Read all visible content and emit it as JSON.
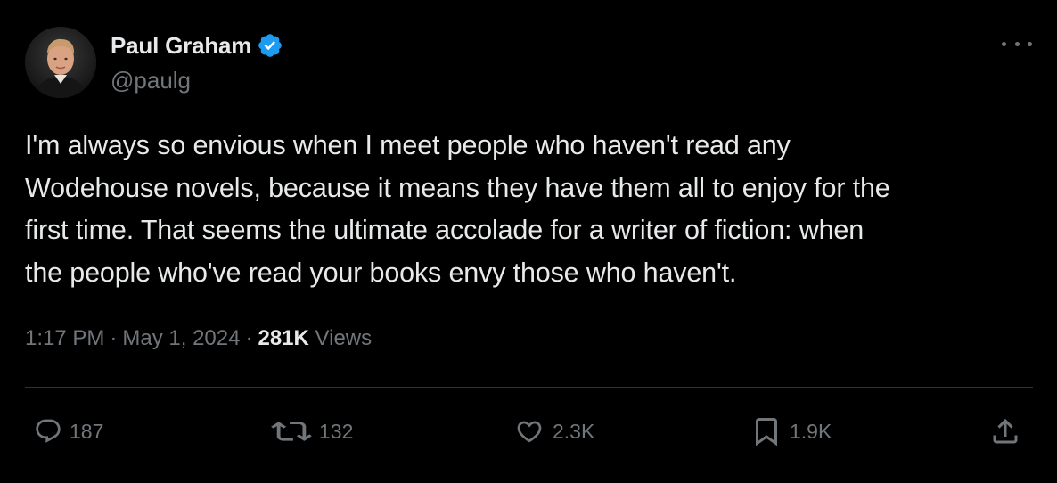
{
  "author": {
    "display_name": "Paul Graham",
    "handle": "@paulg",
    "verified": true,
    "verified_color": "#1d9bf0"
  },
  "tweet": {
    "lines": [
      "I'm always so envious when I meet people who haven't read any",
      "Wodehouse novels, because it means they have them all to enjoy for the",
      "first time. That seems the ultimate accolade for a writer of fiction: when",
      "the people who've read your books envy those who haven't."
    ]
  },
  "meta": {
    "time": "1:17 PM",
    "separator": "·",
    "date": "May 1, 2024",
    "views_count": "281K",
    "views_label": "Views"
  },
  "actions": {
    "replies": "187",
    "reposts": "132",
    "likes": "2.3K",
    "bookmarks": "1.9K"
  },
  "icons": {
    "more": "more-horizontal-icon",
    "reply": "reply-icon",
    "repost": "repost-icon",
    "like": "heart-icon",
    "bookmark": "bookmark-icon",
    "share": "share-icon"
  },
  "colors": {
    "background": "#000000",
    "text_primary": "#e7e9ea",
    "text_secondary": "#71767b",
    "divider": "#2f3336"
  }
}
